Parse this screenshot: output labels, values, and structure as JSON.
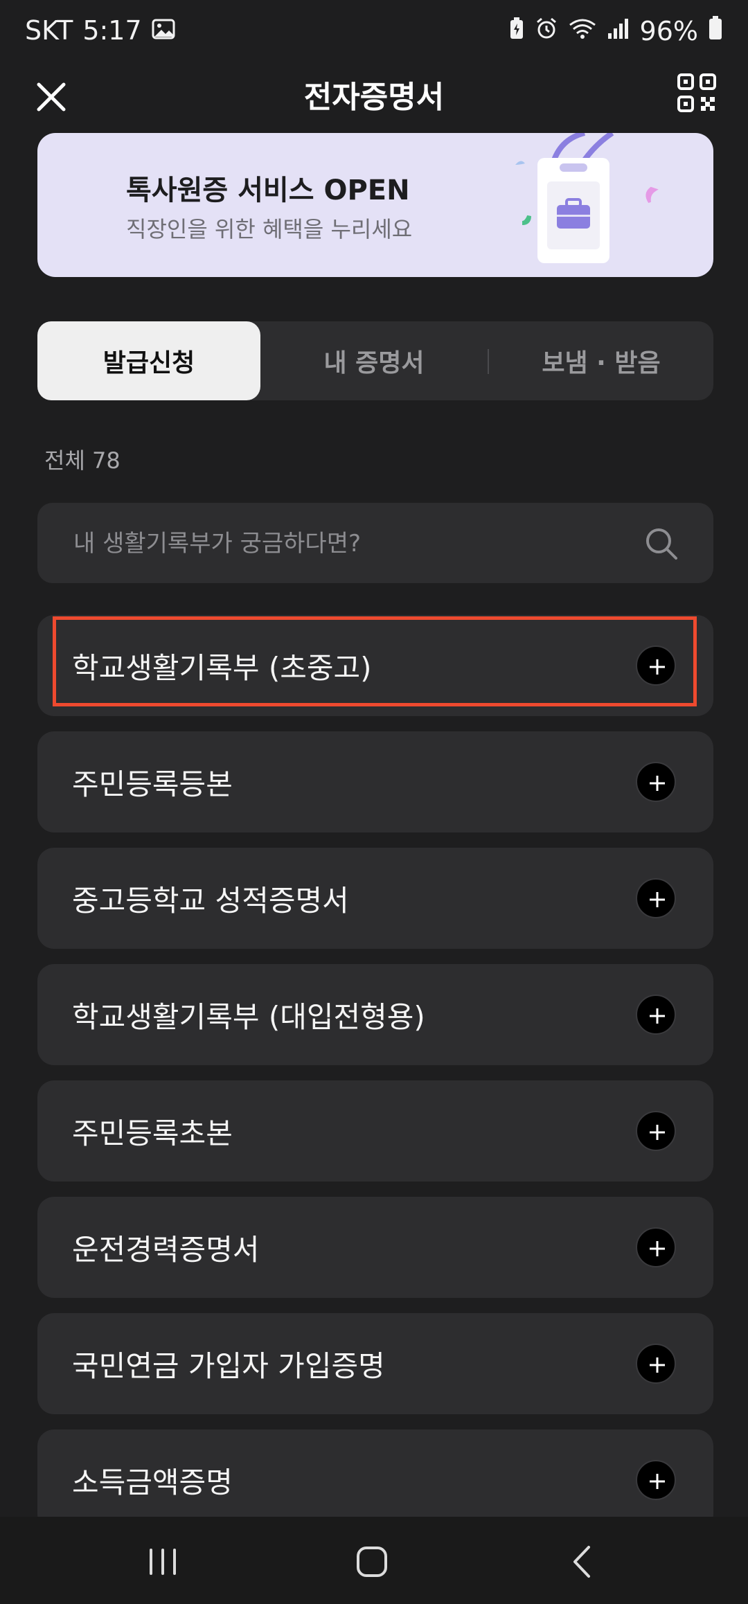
{
  "status_bar": {
    "carrier": "SKT",
    "time": "5:17",
    "battery": "96%"
  },
  "header": {
    "title": "전자증명서"
  },
  "banner": {
    "title": "톡사원증 서비스 OPEN",
    "subtitle": "직장인을 위한 혜택을 누리세요"
  },
  "tabs": [
    {
      "label": "발급신청",
      "active": true
    },
    {
      "label": "내 증명서",
      "active": false
    },
    {
      "label": "보냄 · 받음",
      "active": false
    }
  ],
  "count": "전체 78",
  "search": {
    "placeholder": "내 생활기록부가 궁금하다면?"
  },
  "documents": [
    {
      "label": "학교생활기록부 (초중고)",
      "highlighted": true
    },
    {
      "label": "주민등록등본"
    },
    {
      "label": "중고등학교 성적증명서"
    },
    {
      "label": "학교생활기록부 (대입전형용)"
    },
    {
      "label": "주민등록초본"
    },
    {
      "label": "운전경력증명서"
    },
    {
      "label": "국민연금 가입자 가입증명"
    },
    {
      "label": "소득금액증명"
    }
  ],
  "colors": {
    "background": "#1e1e1f",
    "card": "#2d2d2f",
    "banner": "#e4e1f6",
    "highlight": "#ee4a2f",
    "accent_purple": "#8b7fe0"
  }
}
